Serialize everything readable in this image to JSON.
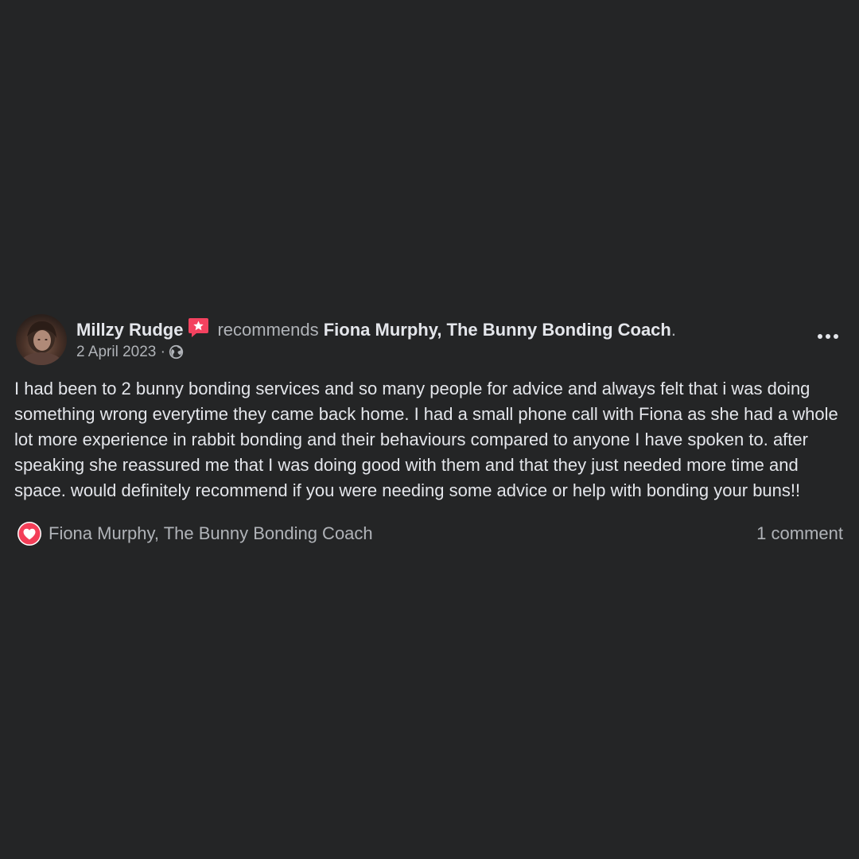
{
  "post": {
    "author": "Millzy Rudge",
    "action": "recommends",
    "page_name": "Fiona Murphy, The Bunny Bonding Coach",
    "trailing_punct": ".",
    "date": "2 April 2023",
    "separator": "·",
    "privacy_icon": "globe-icon",
    "badge_icon": "recommendation-star-icon",
    "more_icon": "more-options-icon",
    "text": "I had been to 2 bunny bonding services and so many people for advice and always felt that i was doing something wrong everytime they came back home. I had a small phone call with Fiona as she had a whole lot more experience in rabbit bonding and their behaviours compared to anyone I have spoken to. after speaking she reassured me that I was doing good with them and that they just needed more time and space. would definitely recommend if you were needing some advice or help with bonding your buns!!"
  },
  "reactions": {
    "icon": "love-reaction-icon",
    "reactor": "Fiona Murphy, The Bunny Bonding Coach",
    "comment_count": "1 comment"
  },
  "colors": {
    "background": "#242526",
    "primary_text": "#e4e6eb",
    "secondary_text": "#b0b3b8",
    "badge": "#f3425f",
    "love_reaction": "#f33e58"
  }
}
